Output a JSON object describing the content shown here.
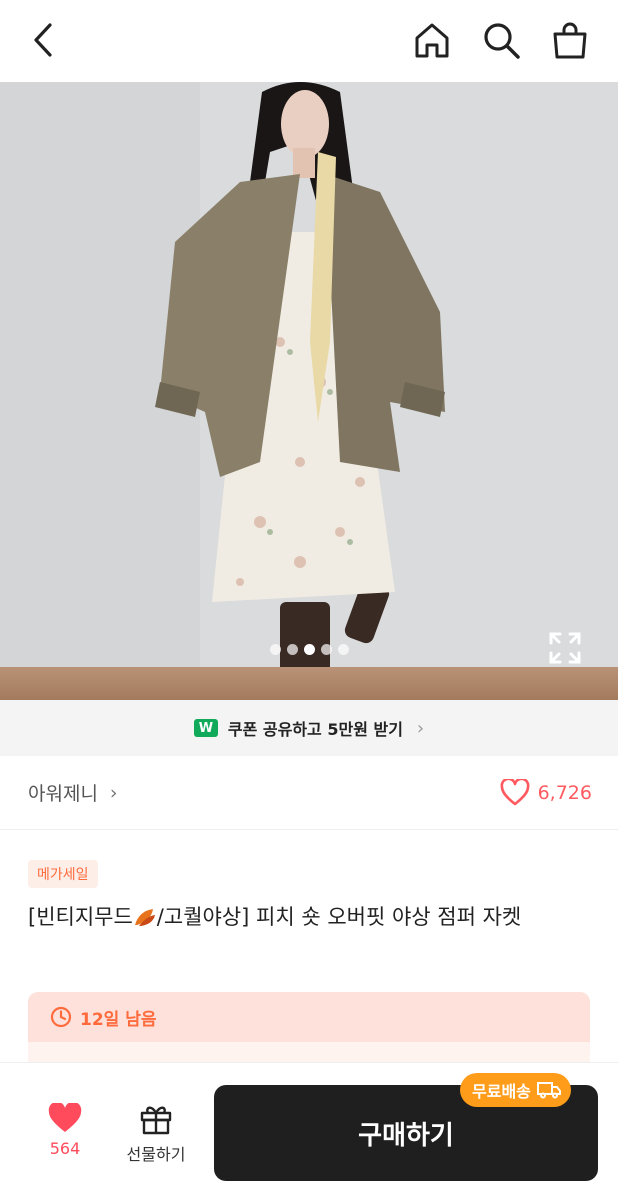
{
  "header": {
    "back_icon": "chevron-left-icon",
    "home_icon": "home-icon",
    "search_icon": "search-icon",
    "cart_icon": "shopping-bag-icon"
  },
  "gallery": {
    "dot_count": 5,
    "active_dot": 3,
    "expand_icon": "expand-icon"
  },
  "coupon": {
    "badge": "W",
    "text": "쿠폰 공유하고 5만원 받기",
    "chevron": "›"
  },
  "shop": {
    "name": "아워제니",
    "chevron": "›",
    "like_count": "6,726",
    "heart_icon": "heart-outline-icon"
  },
  "product": {
    "badge": "메가세일",
    "title_part1": "[빈티지무드",
    "title_part2": "/고퀄야상] 피치 숏 오버핏 야상 점퍼 자켓"
  },
  "deadline": {
    "icon": "clock-icon",
    "text": "12일 남음"
  },
  "bottom": {
    "wish_count": "564",
    "gift_label": "선물하기",
    "buy_label": "구매하기",
    "free_shipping": "무료배송"
  },
  "colors": {
    "accent": "#ff5a5f",
    "buy_button": "#1f1f1f",
    "free_shipping": "#ff9c1a",
    "coupon_badge": "#11a95a"
  }
}
